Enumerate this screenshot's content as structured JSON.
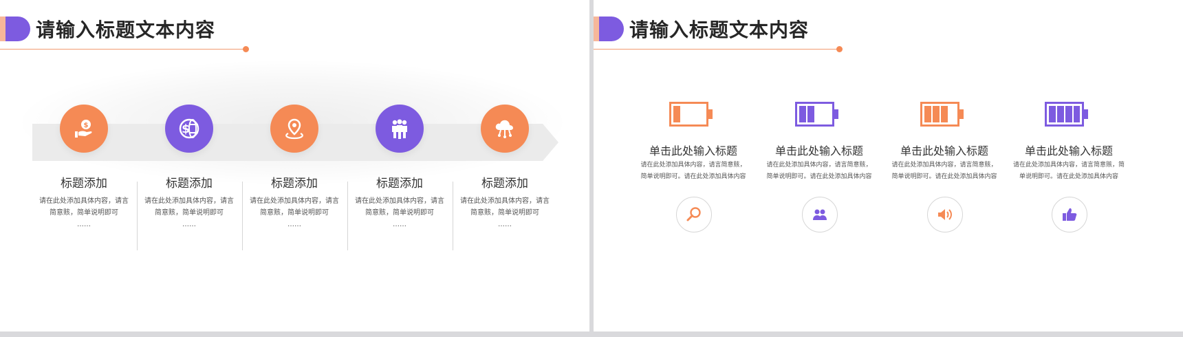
{
  "colors": {
    "orange": "#f58a55",
    "purple": "#7d5be0",
    "peach": "#f7b79a"
  },
  "left_slide": {
    "title": "请输入标题文本内容",
    "steps": [
      {
        "icon": "money-hand-icon",
        "color": "#f58a55",
        "title": "标题添加",
        "desc": [
          "请在此处添加具体内容，请言",
          "简意赅，简单说明即可",
          "……"
        ]
      },
      {
        "icon": "dollar-globe-icon",
        "color": "#7d5be0",
        "title": "标题添加",
        "desc": [
          "请在此处添加具体内容，请言",
          "简意赅，简单说明即可",
          "……"
        ]
      },
      {
        "icon": "location-pin-icon",
        "color": "#f58a55",
        "title": "标题添加",
        "desc": [
          "请在此处添加具体内容，请言",
          "简意赅，简单说明即可",
          "……"
        ]
      },
      {
        "icon": "team-icon",
        "color": "#7d5be0",
        "title": "标题添加",
        "desc": [
          "请在此处添加具体内容，请言",
          "简意赅，简单说明即可",
          "……"
        ]
      },
      {
        "icon": "cloud-network-icon",
        "color": "#f58a55",
        "title": "标题添加",
        "desc": [
          "请在此处添加具体内容，请言",
          "简意赅，简单说明即可",
          "……"
        ]
      }
    ]
  },
  "right_slide": {
    "title": "请输入标题文本内容",
    "cards": [
      {
        "battery_color": "#f58a55",
        "battery_level": 1,
        "title": "单击此处输入标题",
        "desc": [
          "请在此处添加具体内容，请言简意赅，",
          "简单说明即可。请在此处添加具体内容"
        ],
        "icon": "search-icon",
        "icon_color": "#f58a55"
      },
      {
        "battery_color": "#7d5be0",
        "battery_level": 2,
        "title": "单击此处输入标题",
        "desc": [
          "请在此处添加具体内容，请言简意赅，",
          "简单说明即可。请在此处添加具体内容"
        ],
        "icon": "users-icon",
        "icon_color": "#7d5be0"
      },
      {
        "battery_color": "#f58a55",
        "battery_level": 3,
        "title": "单击此处输入标题",
        "desc": [
          "请在此处添加具体内容，请言简意赅，",
          "简单说明即可。请在此处添加具体内容"
        ],
        "icon": "speaker-icon",
        "icon_color": "#f58a55"
      },
      {
        "battery_color": "#7d5be0",
        "battery_level": 4,
        "title": "单击此处输入标题",
        "desc": [
          "请在此处添加具体内容，请言简意赅，简",
          "单说明即可。请在此处添加具体内容"
        ],
        "icon": "thumbs-up-icon",
        "icon_color": "#7d5be0"
      }
    ]
  }
}
